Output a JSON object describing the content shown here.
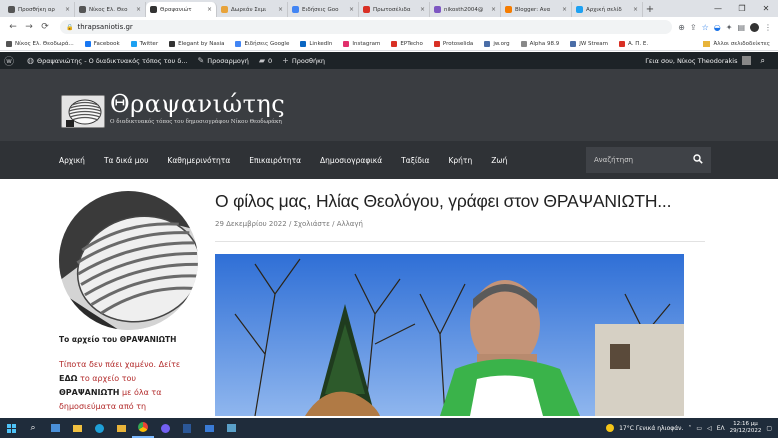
{
  "browser": {
    "tabs": [
      {
        "label": "Προσθήκη αρ",
        "color": "#555555"
      },
      {
        "label": "Νίκος Ελ. Θεο",
        "color": "#555555"
      },
      {
        "label": "Θραψανιώτ",
        "color": "#333333",
        "active": true
      },
      {
        "label": "Δωρεάν Σεμι",
        "color": "#e8a33a"
      },
      {
        "label": "Ειδήσεις Goo",
        "color": "#4285f4"
      },
      {
        "label": "Πρωτοσέλιδα",
        "color": "#d93025"
      },
      {
        "label": "nikosth2004@",
        "color": "#7e57c2"
      },
      {
        "label": "Blogger: Ανα",
        "color": "#f57c00"
      },
      {
        "label": "Αρχική σελίδ",
        "color": "#1da1f2"
      }
    ],
    "tab_close": "×",
    "new_tab": "+",
    "window_controls": {
      "minimize": "—",
      "restore": "❐",
      "close": "✕"
    },
    "nav": {
      "back": "←",
      "forward": "→",
      "reload": "⟳"
    },
    "url": "thrapsaniotis.gr",
    "lock": "🔒",
    "toolbar_icons": [
      "⊕",
      "⇪",
      "☆",
      "◒",
      "✦",
      "▤",
      "▭",
      "⋮"
    ],
    "bookmarks": [
      {
        "label": "Νίκος Ελ. Θεοδωρά...",
        "color": "#555555"
      },
      {
        "label": "Facebook",
        "color": "#1877f2"
      },
      {
        "label": "Twitter",
        "color": "#1da1f2"
      },
      {
        "label": "Elegant by Nasia",
        "color": "#333333"
      },
      {
        "label": "Ειδήσεις Google",
        "color": "#4285f4"
      },
      {
        "label": "LinkedIn",
        "color": "#0a66c2"
      },
      {
        "label": "Instagram",
        "color": "#e1306c"
      },
      {
        "label": "EPTecho",
        "color": "#d93025"
      },
      {
        "label": "Protoselida",
        "color": "#d93025"
      },
      {
        "label": "jw.org",
        "color": "#4a6da7"
      },
      {
        "label": "Alpha 98.9",
        "color": "#888888"
      },
      {
        "label": "JW Stream",
        "color": "#4a6da7"
      },
      {
        "label": "Α. Π. Ε.",
        "color": "#d93025"
      }
    ],
    "bookmarks_other": "Άλλοι σελιδοδείκτες"
  },
  "wp_admin_bar": {
    "wp_logo": "ⓦ",
    "site_name": "Θραψανιώτης - Ο διαδικτυακός τόπος του δ...",
    "customize": "Προσαρμογή",
    "comments_count": "0",
    "new_label": "Προσθήκη",
    "greeting": "Γεια σου, Νίκος Theodorakis",
    "search_icon": "⌕"
  },
  "site": {
    "title": "Θραψανιώτης",
    "tagline": "Ο διαδικτυακός τόπος του δημοσιογράφου Νίκου Θεοδωράκη",
    "nav": [
      "Αρχική",
      "Τα δικά μου",
      "Καθημερινότητα",
      "Επικαιρότητα",
      "Δημοσιογραφικά",
      "Ταξίδια",
      "Κρήτη",
      "Ζωή"
    ],
    "search_placeholder": "Αναζήτηση"
  },
  "sidebar": {
    "archive_title": "Το αρχείο του ΘΡΑΨΑΝΙΩΤΗ",
    "archive_text": {
      "t1": "Τίποτα δεν πάει χαμένο. Δείτε",
      "t2": "ΕΔΩ",
      "t3": "το αρχείο του",
      "t4": "ΘΡΑΨΑΝΙΩΤΗ",
      "t5": "με όλα τα",
      "t6": "δημοσιεύματα από τη"
    }
  },
  "post": {
    "title": "Ο φίλος μας, Ηλίας Θεολόγου, γράφει στον ΘΡΑΨΑΝΙΩΤΗ...",
    "date": "29 Δεκεμβρίου 2022",
    "separator": "/",
    "comment": "Σχολιάστε",
    "category": "Αλλαγή"
  },
  "taskbar": {
    "weather": "17°C Γενικά ηλιοφάν.",
    "lang": "ΕΛ",
    "time": "12:16 μμ",
    "date": "29/12/2022"
  },
  "colors": {
    "header_bg": "#3a3d41",
    "nav_bg": "#2f3236",
    "link_red": "#b22a2a",
    "wp_bar": "#1d2327"
  }
}
